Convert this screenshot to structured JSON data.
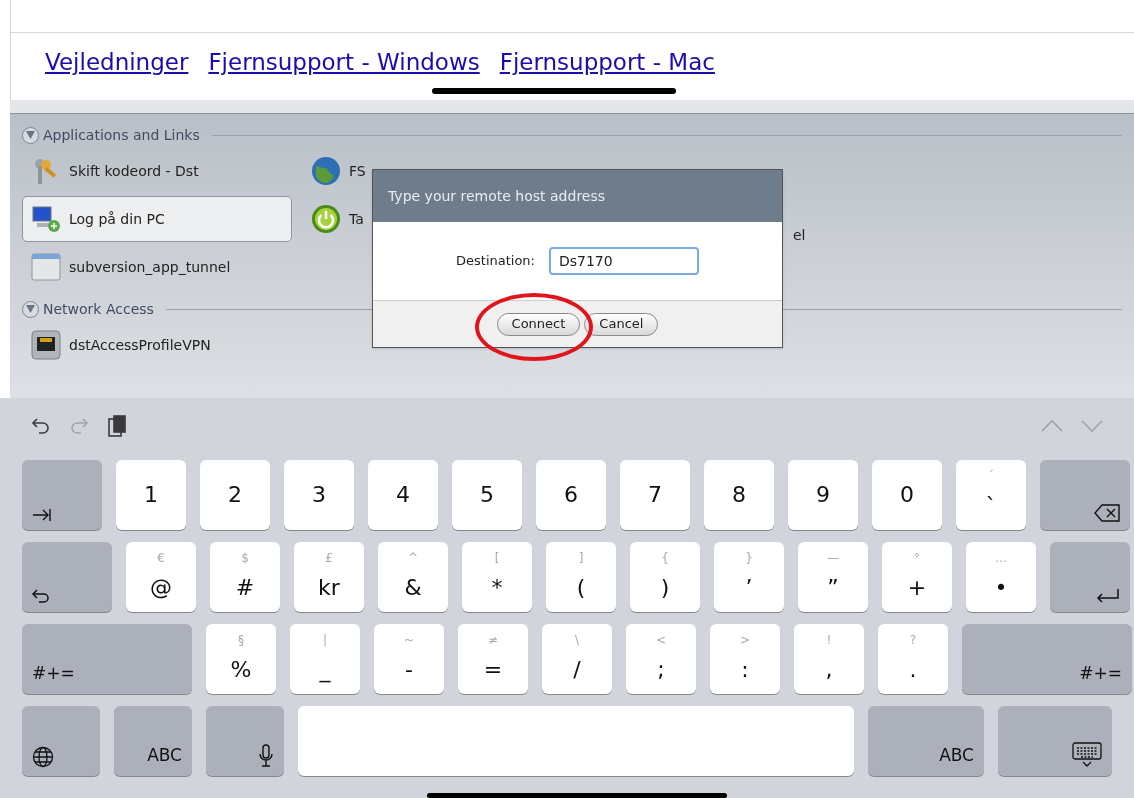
{
  "links": [
    "Vejledninger",
    "Fjernsupport - Windows",
    "Fjernsupport - Mac"
  ],
  "sections": [
    {
      "title": "Applications and Links",
      "expanded": true,
      "items": [
        {
          "label": "Skift kodeord - Dst",
          "kind": "key",
          "selected": false
        },
        {
          "label": "Log på din PC",
          "kind": "computer",
          "selected": true
        },
        {
          "label": "subversion_app_tunnel",
          "kind": "window",
          "selected": false
        },
        {
          "label": "FS",
          "kind": "globe",
          "selected": false
        },
        {
          "label": "Ta",
          "kind": "power",
          "selected": false
        },
        {
          "label": "el",
          "kind": "none",
          "selected": false
        }
      ]
    },
    {
      "title": "Network Access",
      "expanded": true,
      "items": [
        {
          "label": "dstAccessProfileVPN",
          "kind": "port",
          "selected": false
        }
      ]
    }
  ],
  "dialog": {
    "title": "Type your remote host address",
    "field_label": "Destination:",
    "value": "Ds7170",
    "buttons": [
      "Connect",
      "Cancel"
    ]
  },
  "toolbar": [
    {
      "kind": "undo",
      "disabled": false
    },
    {
      "kind": "redo",
      "disabled": true
    },
    {
      "kind": "paste",
      "disabled": false
    },
    {
      "kind": "up",
      "disabled": true
    },
    {
      "kind": "down",
      "disabled": true
    }
  ],
  "keyboard": [
    [
      {
        "kind": "tab"
      },
      {
        "kind": "char",
        "label": "1"
      },
      {
        "kind": "char",
        "label": "2"
      },
      {
        "kind": "char",
        "label": "3"
      },
      {
        "kind": "char",
        "label": "4"
      },
      {
        "kind": "char",
        "label": "5"
      },
      {
        "kind": "char",
        "label": "6"
      },
      {
        "kind": "char",
        "label": "7"
      },
      {
        "kind": "char",
        "label": "8"
      },
      {
        "kind": "char",
        "label": "9"
      },
      {
        "kind": "char",
        "label": "0"
      },
      {
        "kind": "char",
        "label": "`",
        "alt": "´"
      },
      {
        "kind": "backspace"
      }
    ],
    [
      {
        "kind": "undo"
      },
      {
        "kind": "char",
        "label": "@",
        "alt": "€"
      },
      {
        "kind": "char",
        "label": "#",
        "alt": "$"
      },
      {
        "kind": "char",
        "label": "kr",
        "alt": "£"
      },
      {
        "kind": "char",
        "label": "&",
        "alt": "^"
      },
      {
        "kind": "char",
        "label": "*",
        "alt": "["
      },
      {
        "kind": "char",
        "label": "(",
        "alt": "]"
      },
      {
        "kind": "char",
        "label": ")",
        "alt": "{"
      },
      {
        "kind": "char",
        "label": "’",
        "alt": "}"
      },
      {
        "kind": "char",
        "label": "”",
        "alt": "—"
      },
      {
        "kind": "char",
        "label": "+",
        "alt": "°"
      },
      {
        "kind": "char",
        "label": "•",
        "alt": "…"
      },
      {
        "kind": "return"
      }
    ],
    [
      {
        "kind": "symbols",
        "label": "#+="
      },
      {
        "kind": "char",
        "label": "%",
        "alt": "§"
      },
      {
        "kind": "char",
        "label": "_",
        "alt": "|"
      },
      {
        "kind": "char",
        "label": "-",
        "alt": "~"
      },
      {
        "kind": "char",
        "label": "=",
        "alt": "≠"
      },
      {
        "kind": "char",
        "label": "/",
        "alt": "\\"
      },
      {
        "kind": "char",
        "label": ";",
        "alt": "<"
      },
      {
        "kind": "char",
        "label": ":",
        "alt": ">"
      },
      {
        "kind": "char",
        "label": ",",
        "alt": "!"
      },
      {
        "kind": "char",
        "label": ".",
        "alt": "?"
      },
      {
        "kind": "symbols",
        "label": "#+="
      }
    ],
    [
      {
        "kind": "globe"
      },
      {
        "kind": "abc",
        "label": "ABC"
      },
      {
        "kind": "mic"
      },
      {
        "kind": "space"
      },
      {
        "kind": "abc",
        "label": "ABC"
      },
      {
        "kind": "hide"
      }
    ]
  ]
}
